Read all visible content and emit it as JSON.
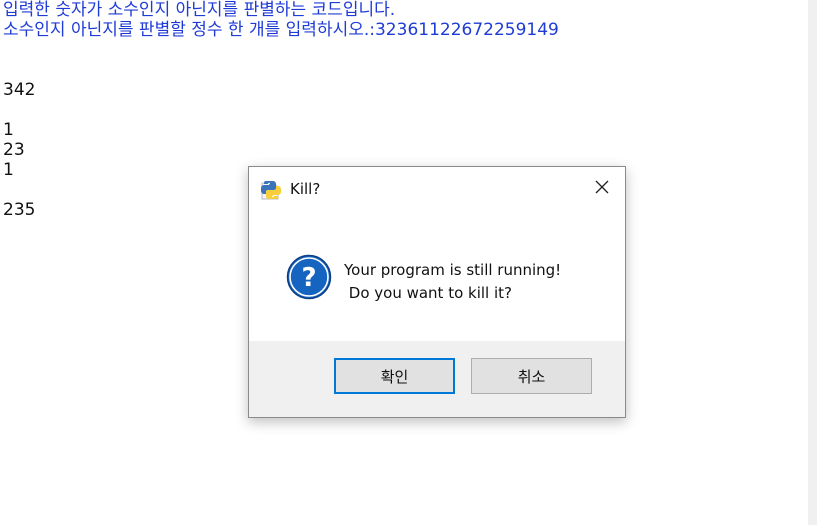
{
  "console": {
    "lines": [
      {
        "text": "입력한 숫자가 소수인지 아닌지를 판별하는 코드입니다.",
        "kind": "prompt"
      },
      {
        "text": "소수인지 아닌지를 판별할 정수 한 개를 입력하시오.:32361122672259149",
        "kind": "prompt"
      },
      {
        "text": "342",
        "kind": "output"
      },
      {
        "text": "1",
        "kind": "output"
      },
      {
        "text": "23",
        "kind": "output"
      },
      {
        "text": "1",
        "kind": "output"
      },
      {
        "text": "235",
        "kind": "output"
      }
    ]
  },
  "dialog": {
    "title": "Kill?",
    "title_icon": "python-icon",
    "message_line1": "Your program is still running!",
    "message_line2": " Do you want to kill it?",
    "ok_label": "확인",
    "cancel_label": "취소",
    "close_icon": "close-icon",
    "question_icon": "question-icon"
  },
  "colors": {
    "prompt": "#1f3bd6",
    "accent": "#0078d7",
    "question_blue": "#1565c0"
  }
}
